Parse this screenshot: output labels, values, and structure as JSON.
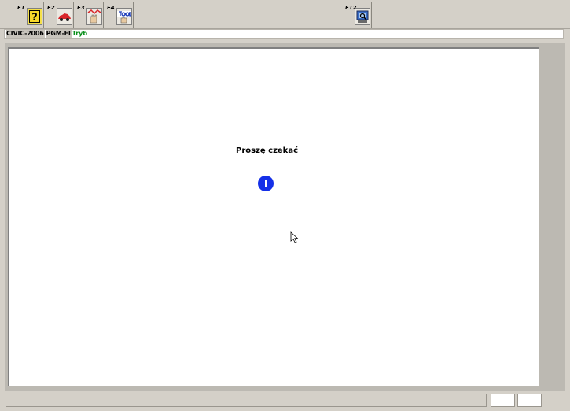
{
  "toolbar": {
    "buttons": [
      {
        "key": "F1",
        "icon": "help-question-icon"
      },
      {
        "key": "F2",
        "icon": "car-icon"
      },
      {
        "key": "F3",
        "icon": "diagnostic-hand-icon"
      },
      {
        "key": "F4",
        "icon": "tool-icon"
      },
      {
        "key": "F12",
        "icon": "monitor-search-icon"
      }
    ]
  },
  "status_line": {
    "model": "CIVIC-2006",
    "system": "PGM-FI",
    "mode": "Tryb"
  },
  "main": {
    "message": "Proszę czekać"
  },
  "colors": {
    "spinner": "#1530e8",
    "mode_text": "#0a8f1a",
    "background": "#d4d0c8"
  }
}
